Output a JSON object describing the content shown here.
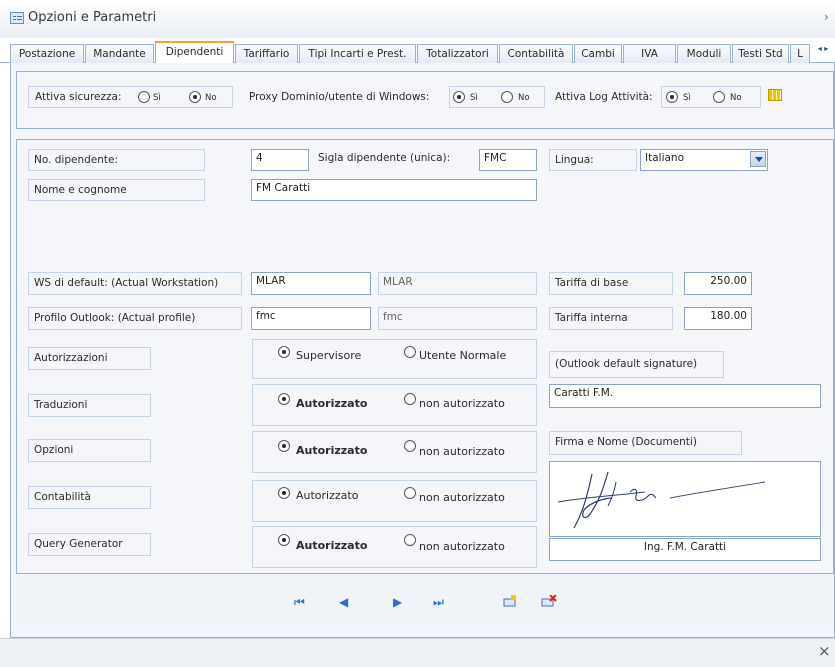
{
  "window": {
    "title": "Opzioni e Parametri",
    "close_glyph": "×"
  },
  "tabs": [
    {
      "label": "Postazione"
    },
    {
      "label": "Mandante"
    },
    {
      "label": "Dipendenti",
      "active": true
    },
    {
      "label": "Tariffario"
    },
    {
      "label": "Tipi Incarti e Prest."
    },
    {
      "label": "Totalizzatori"
    },
    {
      "label": "Contabilità"
    },
    {
      "label": "Cambi"
    },
    {
      "label": "IVA"
    },
    {
      "label": "Moduli"
    },
    {
      "label": "Testi Std"
    },
    {
      "label": "L"
    }
  ],
  "tab_scroll": "◂ ▸",
  "topbar": {
    "sicurezza_label": "Attiva sicurezza:",
    "sicurezza_si": "Sì",
    "sicurezza_no": "No",
    "sicurezza_value": "No",
    "proxy_label": "Proxy Dominio/utente di Windows:",
    "proxy_si": "Sì",
    "proxy_no": "No",
    "proxy_value": "Sì",
    "log_label": "Attiva Log Attività:",
    "log_si": "Sì",
    "log_no": "No",
    "log_value": "Sì",
    "list_icon": "table-grid-icon"
  },
  "form": {
    "no_dipendente_label": "No. dipendente:",
    "no_dipendente_value": "4",
    "sigla_label": "Sigla dipendente (unica):",
    "sigla_value": "FMC",
    "lingua_label": "Lingua:",
    "lingua_value": "Italiano",
    "nome_label": "Nome e cognome",
    "nome_value": "FM Caratti",
    "ws_label": "WS di default: (Actual Workstation)",
    "ws_value": "MLAR",
    "ws_actual": "MLAR",
    "outlook_label": "Profilo Outlook: (Actual profile)",
    "outlook_value": "fmc",
    "outlook_actual": "fmc",
    "tariffa_base_label": "Tariffa di base",
    "tariffa_base_value": "250.00",
    "tariffa_interna_label": "Tariffa interna",
    "tariffa_interna_value": "180.00",
    "signature_label": "(Outlook default signature)",
    "signature_value": "Caratti F.M.",
    "firma_label": "Firma e Nome (Documenti)",
    "firma_nome_value": "Ing. F.M. Caratti"
  },
  "permissions": [
    {
      "label": "Autorizzazioni",
      "opt1": "Supervisore",
      "opt2": "Utente Normale",
      "selected": 1,
      "bold": false
    },
    {
      "label": "Traduzioni",
      "opt1": "Autorizzato",
      "opt2": "non autorizzato",
      "selected": 1,
      "bold": true
    },
    {
      "label": "Opzioni",
      "opt1": "Autorizzato",
      "opt2": "non autorizzato",
      "selected": 1,
      "bold": true
    },
    {
      "label": "Contabilità",
      "opt1": "Autorizzato",
      "opt2": "non autorizzato",
      "selected": 1,
      "bold": false
    },
    {
      "label": "Query Generator",
      "opt1": "Autorizzato",
      "opt2": "non autorizzato",
      "selected": 1,
      "bold": true
    }
  ],
  "navigation": {
    "first": "⏮",
    "prev": "◀",
    "next": "▶",
    "last": "⏭"
  },
  "colors": {
    "accent_tab": "#f0a040",
    "border": "#9ab0cf",
    "nav_blue": "#2d6fc9"
  }
}
